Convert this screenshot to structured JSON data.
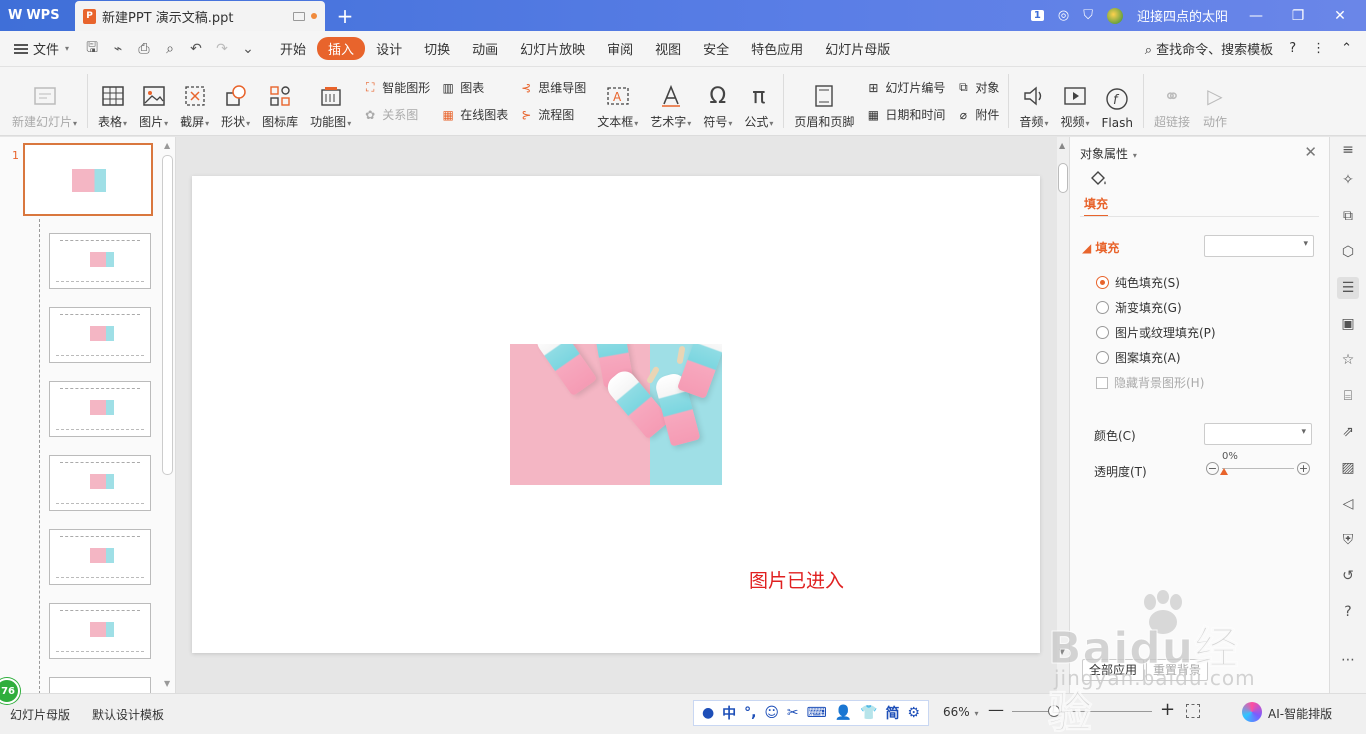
{
  "titlebar": {
    "app_name": "WPS",
    "doc_tab": "新建PPT 演示文稿.ppt",
    "badge": "1",
    "user_name": "迎接四点的太阳"
  },
  "menubar": {
    "file": "文件",
    "tabs": [
      "开始",
      "插入",
      "设计",
      "切换",
      "动画",
      "幻灯片放映",
      "审阅",
      "视图",
      "安全",
      "特色应用",
      "幻灯片母版"
    ],
    "active_tab": "插入",
    "search": "查找命令、搜索模板"
  },
  "ribbon": {
    "new_slide": "新建幻灯片",
    "table": "表格",
    "picture": "图片",
    "screenshot": "截屏",
    "shape": "形状",
    "icon_lib": "图标库",
    "func_chart": "功能图",
    "smart_shape": "智能图形",
    "chart": "图表",
    "relation": "关系图",
    "online_chart": "在线图表",
    "mind_map": "思维导图",
    "flowchart": "流程图",
    "textbox": "文本框",
    "art_text": "艺术字",
    "symbol": "符号",
    "formula": "公式",
    "header_footer": "页眉和页脚",
    "slide_number": "幻灯片编号",
    "object": "对象",
    "date_time": "日期和时间",
    "attachment": "附件",
    "audio": "音频",
    "video": "视频",
    "flash": "Flash",
    "hyperlink": "超链接",
    "action": "动作"
  },
  "thumbnails": {
    "current_number": "1"
  },
  "slide": {
    "caption": "图片已进入"
  },
  "props": {
    "title": "对象属性",
    "fill_tab": "填充",
    "fill_section": "填充",
    "options": [
      "纯色填充(S)",
      "渐变填充(G)",
      "图片或纹理填充(P)",
      "图案填充(A)"
    ],
    "selected_option": 0,
    "hide_bg": "隐藏背景图形(H)",
    "color_label": "颜色(C)",
    "opacity_label": "透明度(T)",
    "opacity_value": "0%",
    "apply_all": "全部应用",
    "reset_bg": "重置背景"
  },
  "statusbar": {
    "master": "幻灯片母版",
    "template": "默认设计模板",
    "ime": [
      "中",
      "°,",
      "☺",
      "✂",
      "⌨",
      "👤",
      "👕",
      "简",
      "⚙"
    ],
    "zoom": "66%",
    "ai": "AI-智能排版",
    "badge": "76"
  },
  "watermark": {
    "main": "Baidu经验",
    "sub": "jingyan.baidu.com"
  },
  "colors": {
    "accent": "#e8642c",
    "titlebar": "#3f6fd8",
    "caption": "#e02020"
  }
}
